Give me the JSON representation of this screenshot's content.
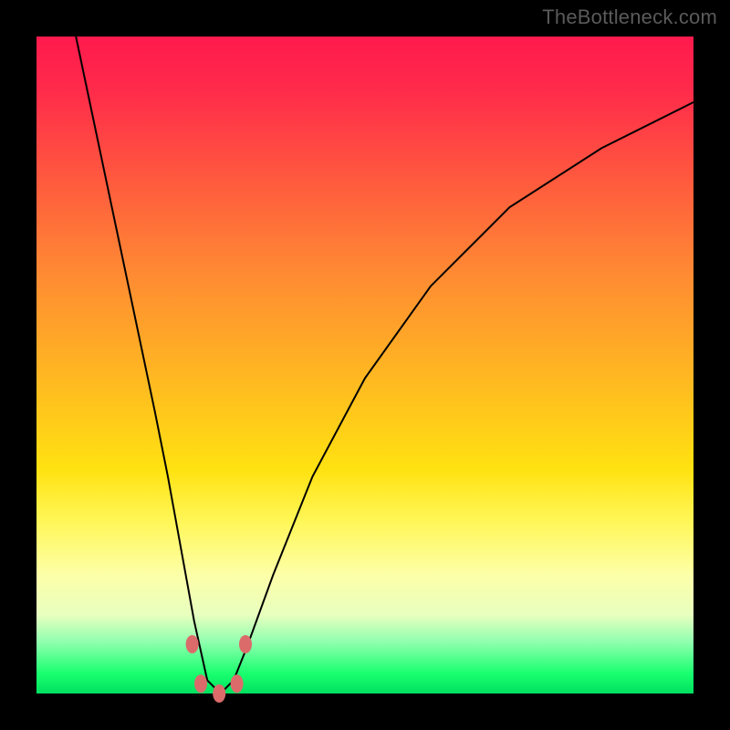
{
  "watermark": "TheBottleneck.com",
  "colors": {
    "frame": "#000000",
    "marker": "#db6b6b",
    "curve": "#000000"
  },
  "chart_data": {
    "type": "line",
    "title": "",
    "xlabel": "",
    "ylabel": "",
    "xlim": [
      0,
      1
    ],
    "ylim": [
      0,
      1
    ],
    "grid": false,
    "legend": false,
    "note": "Axis values unlabeled in source image; x and y are normalized 0–1. y=1 at top (red), y=0 at bottom (green). Curve is a V-shape with minimum near x≈0.27, y≈0.",
    "series": [
      {
        "name": "curve",
        "x": [
          0.06,
          0.1,
          0.14,
          0.18,
          0.2,
          0.22,
          0.24,
          0.26,
          0.28,
          0.3,
          0.32,
          0.36,
          0.42,
          0.5,
          0.6,
          0.72,
          0.86,
          1.0
        ],
        "y": [
          1.0,
          0.81,
          0.62,
          0.43,
          0.33,
          0.22,
          0.11,
          0.02,
          0.0,
          0.02,
          0.07,
          0.18,
          0.33,
          0.48,
          0.62,
          0.74,
          0.83,
          0.9
        ]
      }
    ],
    "markers": {
      "name": "highlighted-points",
      "x": [
        0.237,
        0.25,
        0.278,
        0.305,
        0.318
      ],
      "y": [
        0.075,
        0.015,
        0.0,
        0.015,
        0.075
      ]
    }
  }
}
